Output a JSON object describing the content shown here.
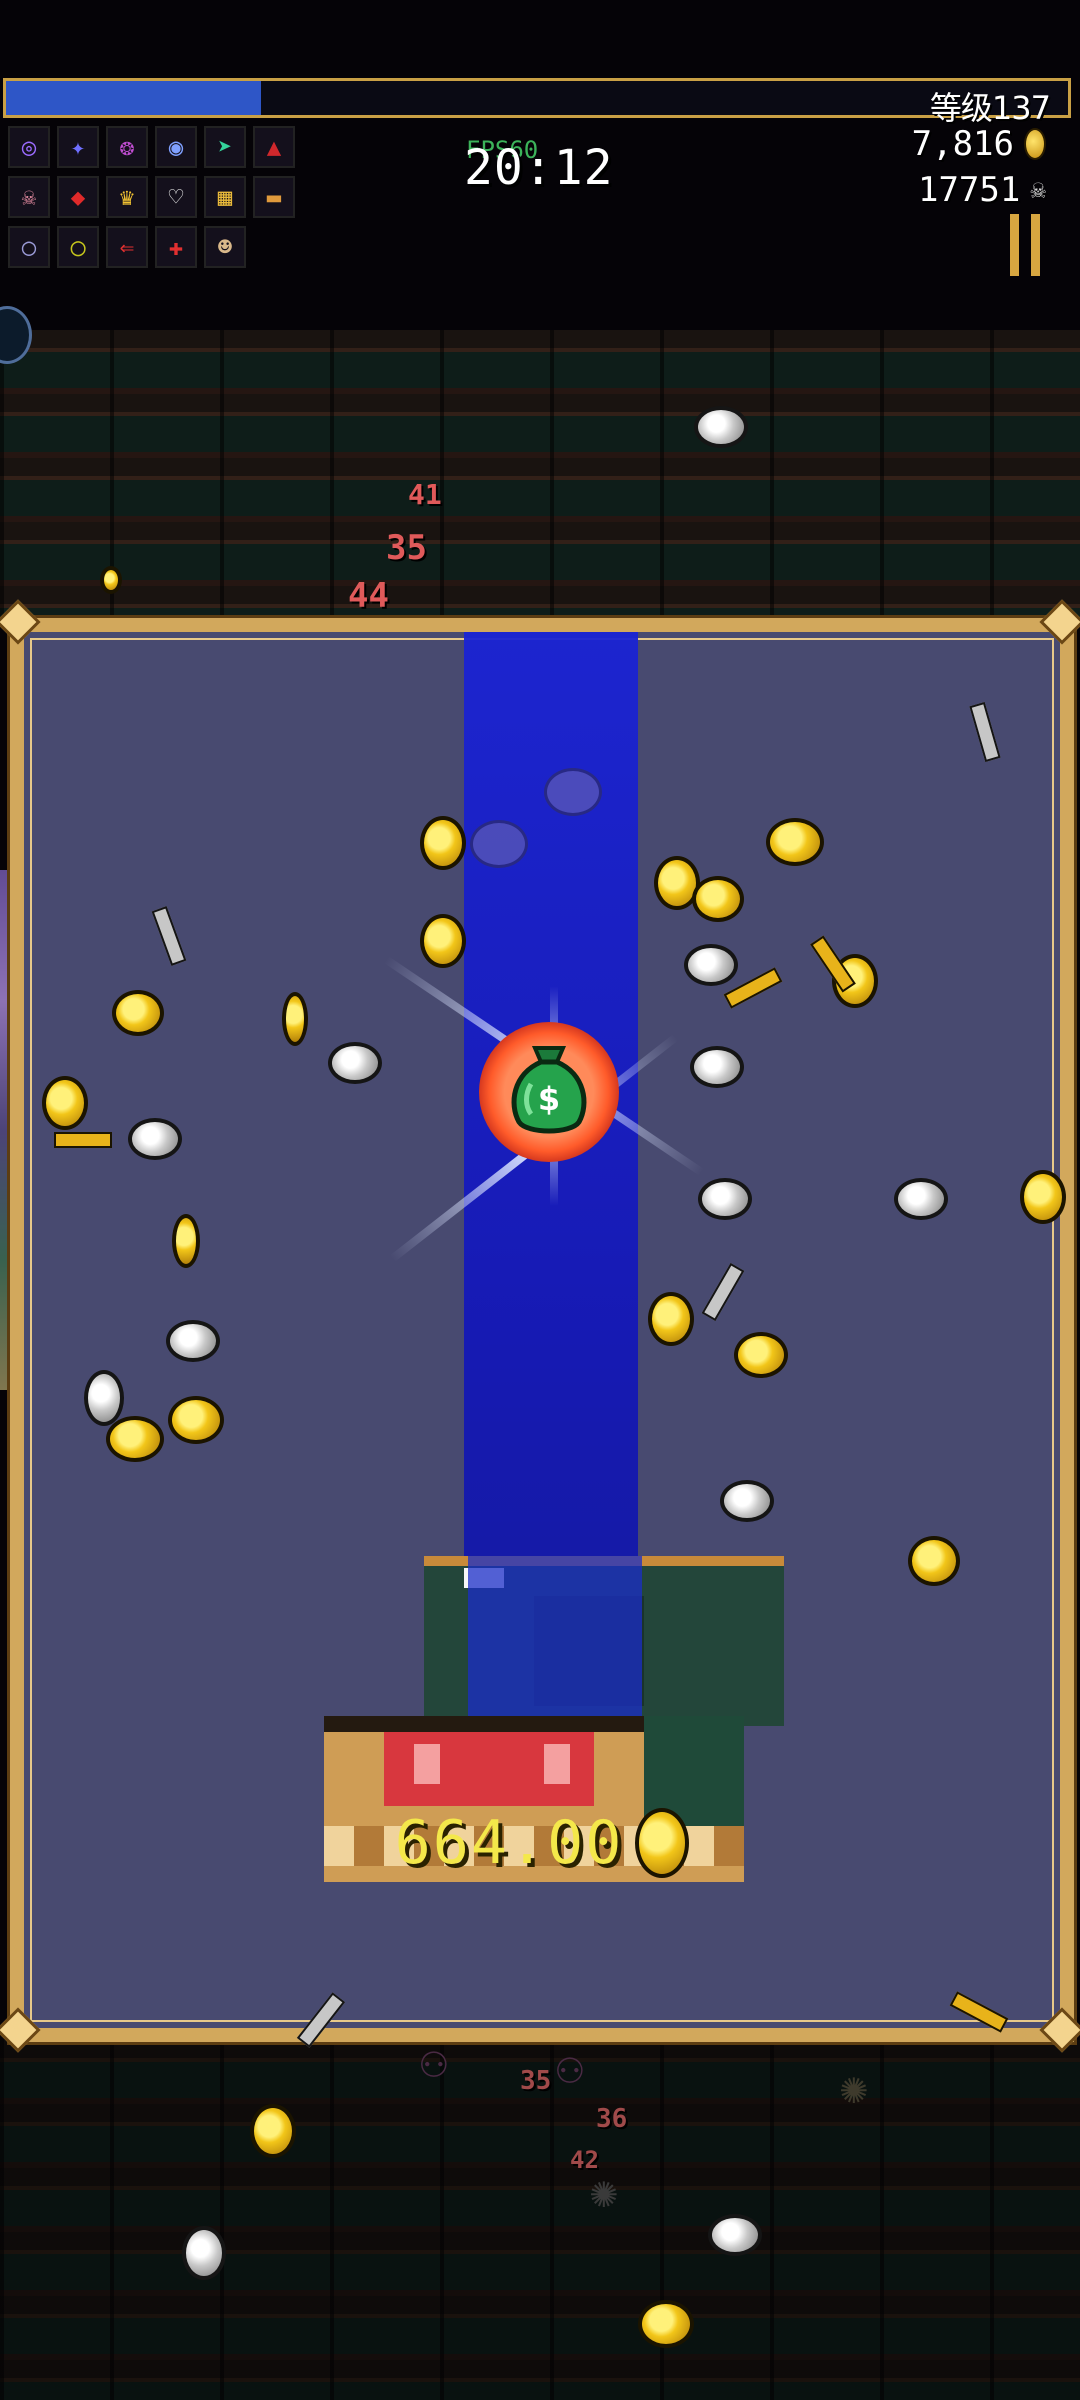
{
  "hud": {
    "level_label": "等级137",
    "xp_progress": 0.24,
    "fps": "FPS60",
    "timer": "20:12",
    "gold": "7,816",
    "kills": "17751"
  },
  "items": [
    {
      "icon": "target-rune-icon",
      "glyph": "◎",
      "color": "#9b6bff"
    },
    {
      "icon": "spellbook-icon",
      "glyph": "✦",
      "color": "#6f6fff"
    },
    {
      "icon": "purple-swirl-icon",
      "glyph": "❂",
      "color": "#c04dd1"
    },
    {
      "icon": "blue-orb-icon",
      "glyph": "◉",
      "color": "#7fa0ff"
    },
    {
      "icon": "arrow-icon",
      "glyph": "➤",
      "color": "#34d39a"
    },
    {
      "icon": "red-cloak-icon",
      "glyph": "▲",
      "color": "#d0282c"
    },
    {
      "icon": "skull-icon",
      "glyph": "☠",
      "color": "#e38aa0"
    },
    {
      "icon": "red-armor-icon",
      "glyph": "◆",
      "color": "#e02a2a"
    },
    {
      "icon": "crown-icon",
      "glyph": "♛",
      "color": "#f1c232"
    },
    {
      "icon": "heart-icon",
      "glyph": "♡",
      "color": "#eeeeee"
    },
    {
      "icon": "lattice-icon",
      "glyph": "▦",
      "color": "#e8b93a"
    },
    {
      "icon": "bread-icon",
      "glyph": "▬",
      "color": "#e09a3c"
    },
    {
      "icon": "ring-icon",
      "glyph": "○",
      "color": "#9a9ad6"
    },
    {
      "icon": "gold-ring-icon",
      "glyph": "◯",
      "color": "#c6c61d"
    },
    {
      "icon": "red-arrow-left-icon",
      "glyph": "⇐",
      "color": "#e23030"
    },
    {
      "icon": "red-arrow-cross-icon",
      "glyph": "✚",
      "color": "#e23030"
    },
    {
      "icon": "face-icon",
      "glyph": "☻",
      "color": "#d9b88a"
    }
  ],
  "damage_numbers": [
    "41",
    "35",
    "44",
    "35",
    "36",
    "42"
  ],
  "chest_reward": {
    "amount": "664.00"
  }
}
